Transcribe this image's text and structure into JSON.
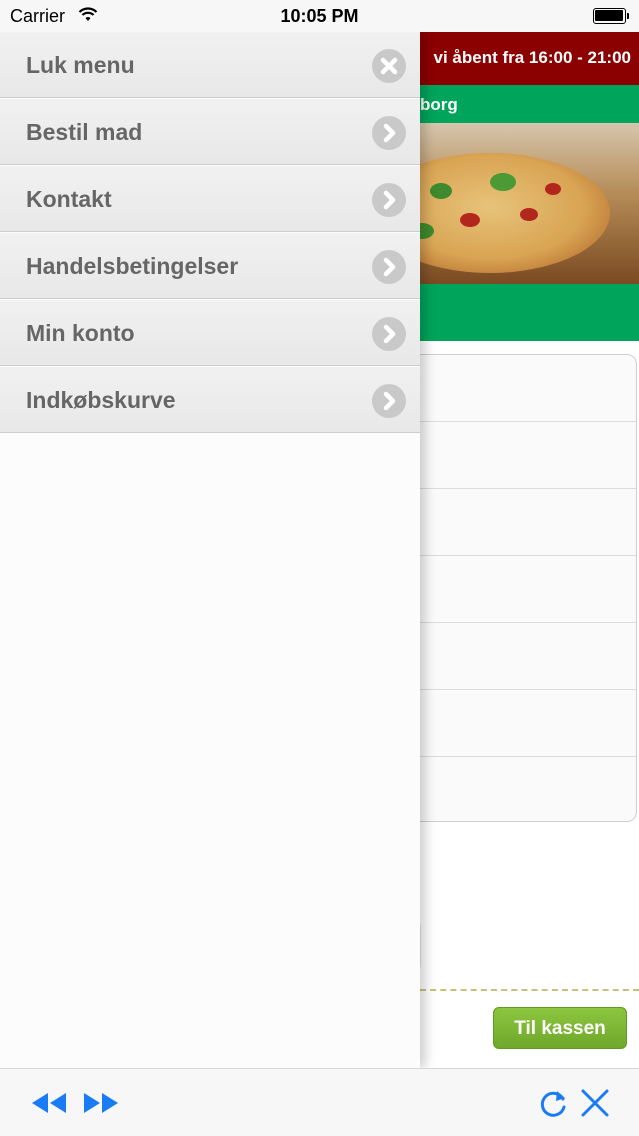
{
  "status_bar": {
    "carrier": "Carrier",
    "time": "10:05 PM"
  },
  "page": {
    "hours_banner": "vi åbent fra 16:00 - 21:00",
    "city_banner": "borg",
    "checkout_button": "Til kassen",
    "colors": {
      "hours_bar": "#8b0000",
      "green_bar": "#00a45a",
      "checkout": "#7ab733"
    }
  },
  "drawer": {
    "items": [
      {
        "label": "Luk menu",
        "icon": "close-icon"
      },
      {
        "label": "Bestil mad",
        "icon": "chevron-right-icon"
      },
      {
        "label": "Kontakt",
        "icon": "chevron-right-icon"
      },
      {
        "label": "Handelsbetingelser",
        "icon": "chevron-right-icon"
      },
      {
        "label": "Min konto",
        "icon": "chevron-right-icon"
      },
      {
        "label": "Indkøbskurve",
        "icon": "chevron-right-icon"
      }
    ]
  },
  "toolbar": {
    "back_icon": "rewind-icon",
    "forward_icon": "fast-forward-icon",
    "reload_icon": "reload-icon",
    "close_icon": "close-icon",
    "accent": "#1a7cf4"
  }
}
